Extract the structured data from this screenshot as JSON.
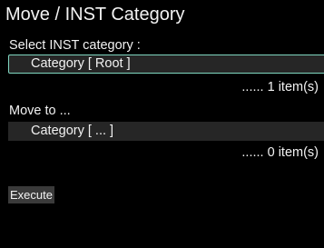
{
  "title": "Move / INST Category",
  "source": {
    "label": "Select INST category :",
    "value": "Category [ Root ]",
    "count": "...... 1 item(s)"
  },
  "target": {
    "label": "Move to ...",
    "value": "Category [ ... ]",
    "count": "...... 0 item(s)"
  },
  "execute_label": "Execute",
  "colors": {
    "background": "#000000",
    "text": "#f2f2f2",
    "field": "#262626",
    "focus": "#7fd6c0",
    "button": "#3a3a3a"
  }
}
